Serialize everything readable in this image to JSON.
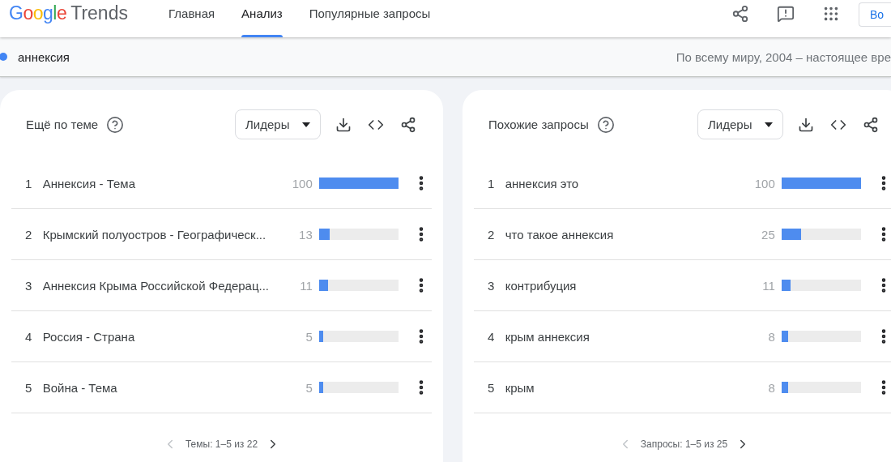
{
  "header": {
    "logo": {
      "brand": "Google",
      "product": "Trends"
    },
    "tabs": [
      {
        "label": "Главная",
        "selected": false
      },
      {
        "label": "Анализ",
        "selected": true
      },
      {
        "label": "Популярные запросы",
        "selected": false
      }
    ],
    "sign_in": "Во"
  },
  "search": {
    "term": "аннексия",
    "color": "#4285f4",
    "scope": "По всему миру, 2004 – настоящее вре"
  },
  "panels": [
    {
      "title": "Ещё по теме",
      "sort": "Лидеры",
      "rows": [
        {
          "rank": "1",
          "label": "Аннексия - Тема",
          "value": "100",
          "level": 1
        },
        {
          "rank": "2",
          "label": "Крымский полуостров - Географическ...",
          "value": "13",
          "level": 0.13
        },
        {
          "rank": "3",
          "label": "Аннексия Крыма Российской Федерац...",
          "value": "11",
          "level": 0.11
        },
        {
          "rank": "4",
          "label": "Россия - Страна",
          "value": "5",
          "level": 0.05
        },
        {
          "rank": "5",
          "label": "Война - Тема",
          "value": "5",
          "level": 0.05
        }
      ],
      "pagination": "Темы: 1–5 из 22"
    },
    {
      "title": "Похожие запросы",
      "sort": "Лидеры",
      "rows": [
        {
          "rank": "1",
          "label": "аннексия это",
          "value": "100",
          "level": 1
        },
        {
          "rank": "2",
          "label": "что такое аннексия",
          "value": "25",
          "level": 0.25
        },
        {
          "rank": "3",
          "label": "контрибуция",
          "value": "11",
          "level": 0.11
        },
        {
          "rank": "4",
          "label": "крым аннексия",
          "value": "8",
          "level": 0.08
        },
        {
          "rank": "5",
          "label": "крым",
          "value": "8",
          "level": 0.08
        }
      ],
      "pagination": "Запросы: 1–5 из 25"
    }
  ]
}
